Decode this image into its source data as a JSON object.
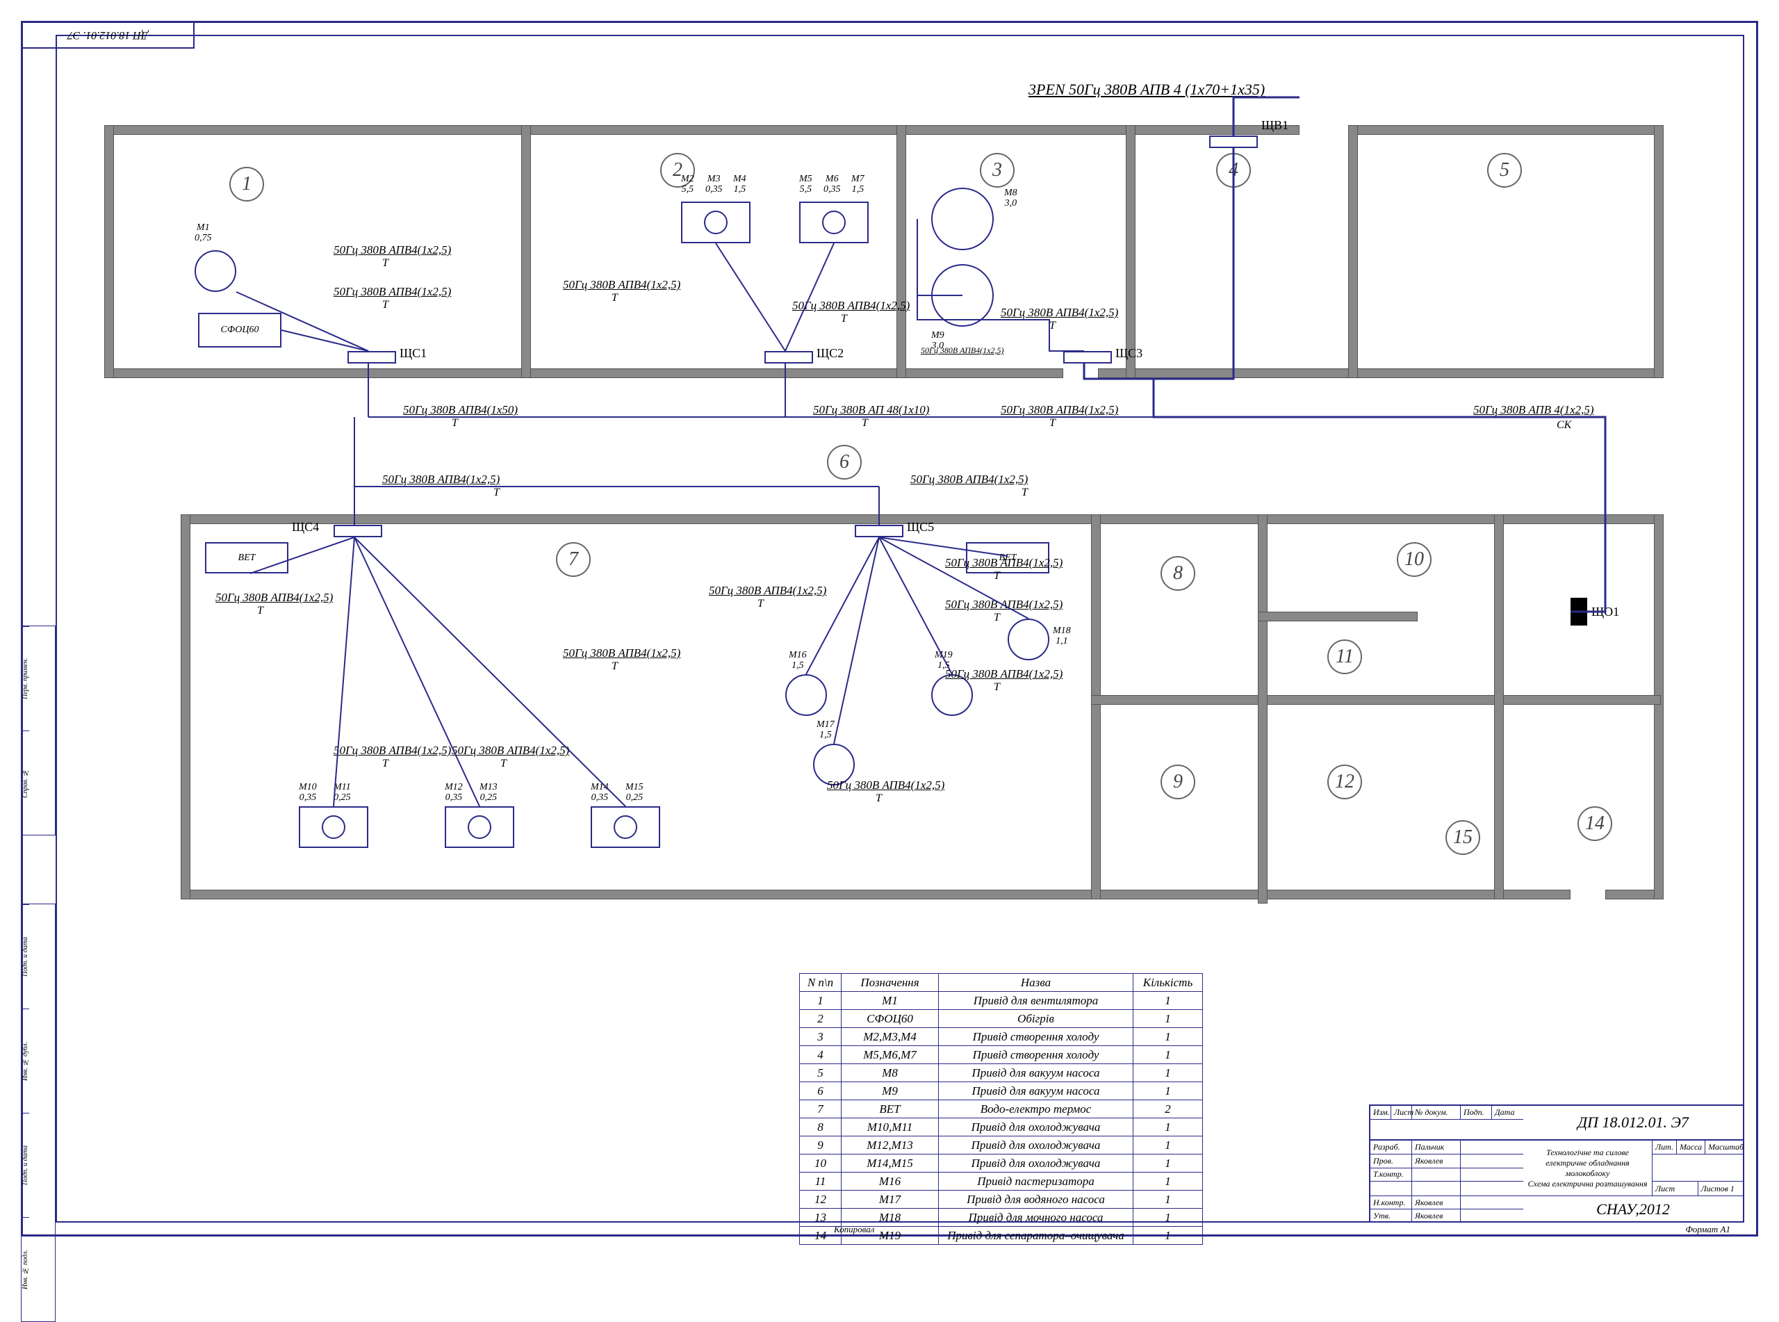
{
  "top_tag": "ДП 18.012.01. Э7",
  "side_tabs": [
    "Перв. примен.",
    "Справ. №",
    "Подп. и дата",
    "Инв. № дубл.",
    "Подп. и дата",
    "Инв. № подл."
  ],
  "feeder": "3PEN 50Гц 380В АПВ 4 (1x70+1x35)",
  "panels": {
    "p1": "ЩС1",
    "p2": "ЩС2",
    "p3": "ЩС3",
    "p4": "ЩС4",
    "p5": "ЩС5",
    "pv": "ЩВ1",
    "po": "ЩО1"
  },
  "devices": {
    "sfoc": "СФОЦ60",
    "vet": "ВЕТ"
  },
  "motors": {
    "m1": "М1\n0,75",
    "m2": "М2\n5,5",
    "m3": "М3\n0,35",
    "m4": "М4\n1,5",
    "m5": "М5\n5,5",
    "m6": "М6\n0,35",
    "m7": "М7\n1,5",
    "m8": "М8\n3,0",
    "m9": "М9\n3,0",
    "m10": "М10\n0,35",
    "m11": "М11\n0,25",
    "m12": "М12\n0,35",
    "m13": "М13\n0,25",
    "m14": "М14\n0,35",
    "m15": "М15\n0,25",
    "m16": "М16\n1,5",
    "m17": "М17\n1,5",
    "m18": "М18\n1,1",
    "m19": "М19\n1,5"
  },
  "cables": {
    "c1": "50Гц 380В АПВ4(1х2,5)",
    "c1a": "50Гц 380В АПВ4(1х2,5)",
    "c2": "50Гц 380В АПВ4(1х2,5)",
    "c3": "50Гц 380В АПВ4(1х2,5)",
    "c4": "50Гц 380В АПВ4(1х2,5)",
    "c5": "50Гц 380В АПВ4(1х2,5)",
    "c6": "50Гц 380В АПВ4(1х2,5)",
    "c7": "50Гц 380В АПВ4(1х2,5)",
    "c8": "50Гц 380В АПВ4(1х2,5)",
    "c9": "50Гц 380В АПВ4(1х2,5)",
    "c10": "50Гц 380В АПВ4(1х2,5)",
    "c11": "50Гц 380В АПВ4(1х2,5)",
    "c12": "50Гц 380В АПВ4(1х2,5)",
    "c13": "50Гц 380В АПВ4(1х2,5)",
    "c14": "50Гц 380В АПВ4(1х2,5)",
    "main1": "50Гц 380В АПВ4(1х50)",
    "main2": "50Гц 380В АП 48(1х10)",
    "main3": "50Гц 380В АПВ4(1х2,5)",
    "main4": "50Гц 380В АПВ 4(1х2,5)",
    "main_ck": "СК",
    "qs3_int": "50Гц 380В АПВ4(1х2,5)"
  },
  "rooms": {
    "r1": "1",
    "r2": "2",
    "r3": "3",
    "r4": "4",
    "r5": "5",
    "r6": "6",
    "r7": "7",
    "r8": "8",
    "r9": "9",
    "r10": "10",
    "r11": "11",
    "r12": "12",
    "r14": "14",
    "r15": "15"
  },
  "table": {
    "headers": [
      "N п\\п",
      "Позначення",
      "Назва",
      "Кількість"
    ],
    "rows": [
      [
        "1",
        "М1",
        "Привід для вентилятора",
        "1"
      ],
      [
        "2",
        "СФОЦ60",
        "Обігрів",
        "1"
      ],
      [
        "3",
        "М2,М3,М4",
        "Привід створення холоду",
        "1"
      ],
      [
        "4",
        "М5,М6,М7",
        "Привід створення холоду",
        "1"
      ],
      [
        "5",
        "М8",
        "Привід для вакуум насоса",
        "1"
      ],
      [
        "6",
        "М9",
        "Привід для вакуум насоса",
        "1"
      ],
      [
        "7",
        "ВЕТ",
        "Водо-електро термос",
        "2"
      ],
      [
        "8",
        "М10,М11",
        "Привід для охолоджувача",
        "1"
      ],
      [
        "9",
        "М12,М13",
        "Привід для охолоджувача",
        "1"
      ],
      [
        "10",
        "М14,М15",
        "Привід для охолоджувача",
        "1"
      ],
      [
        "11",
        "М16",
        "Привід пастеризатора",
        "1"
      ],
      [
        "12",
        "М17",
        "Привід для водяного насоса",
        "1"
      ],
      [
        "13",
        "М18",
        "Привід для мочного насоса",
        "1"
      ],
      [
        "14",
        "М19",
        "Привід для сепаратора–очищувача",
        "1"
      ]
    ]
  },
  "title_block": {
    "code": "ДП 18.012.01. Э7",
    "line1": "Технологічне та силове",
    "line2": "електричне обладнання молокоблоку",
    "line3": "Схема електрична розташування",
    "cols": [
      "Изм.",
      "Лист",
      "№ докум.",
      "Подп.",
      "Дата"
    ],
    "roles": {
      "razrab": "Разраб.",
      "razrab_v": "Пальчик",
      "prov": "Пров.",
      "prov_v": "Яковлев",
      "tkontr": "Т.контр.",
      "nkontr": "Н.контр.",
      "nkontr_v": "Яковлев",
      "utv": "Утв.",
      "utv_v": "Яковлев"
    },
    "right_top": [
      "Лит.",
      "Масса",
      "Масштаб"
    ],
    "right_bot": [
      "Лист",
      "Листов  1"
    ],
    "org": "СНАУ,2012",
    "format": "Формат    А1",
    "kopir": "Копировал"
  }
}
